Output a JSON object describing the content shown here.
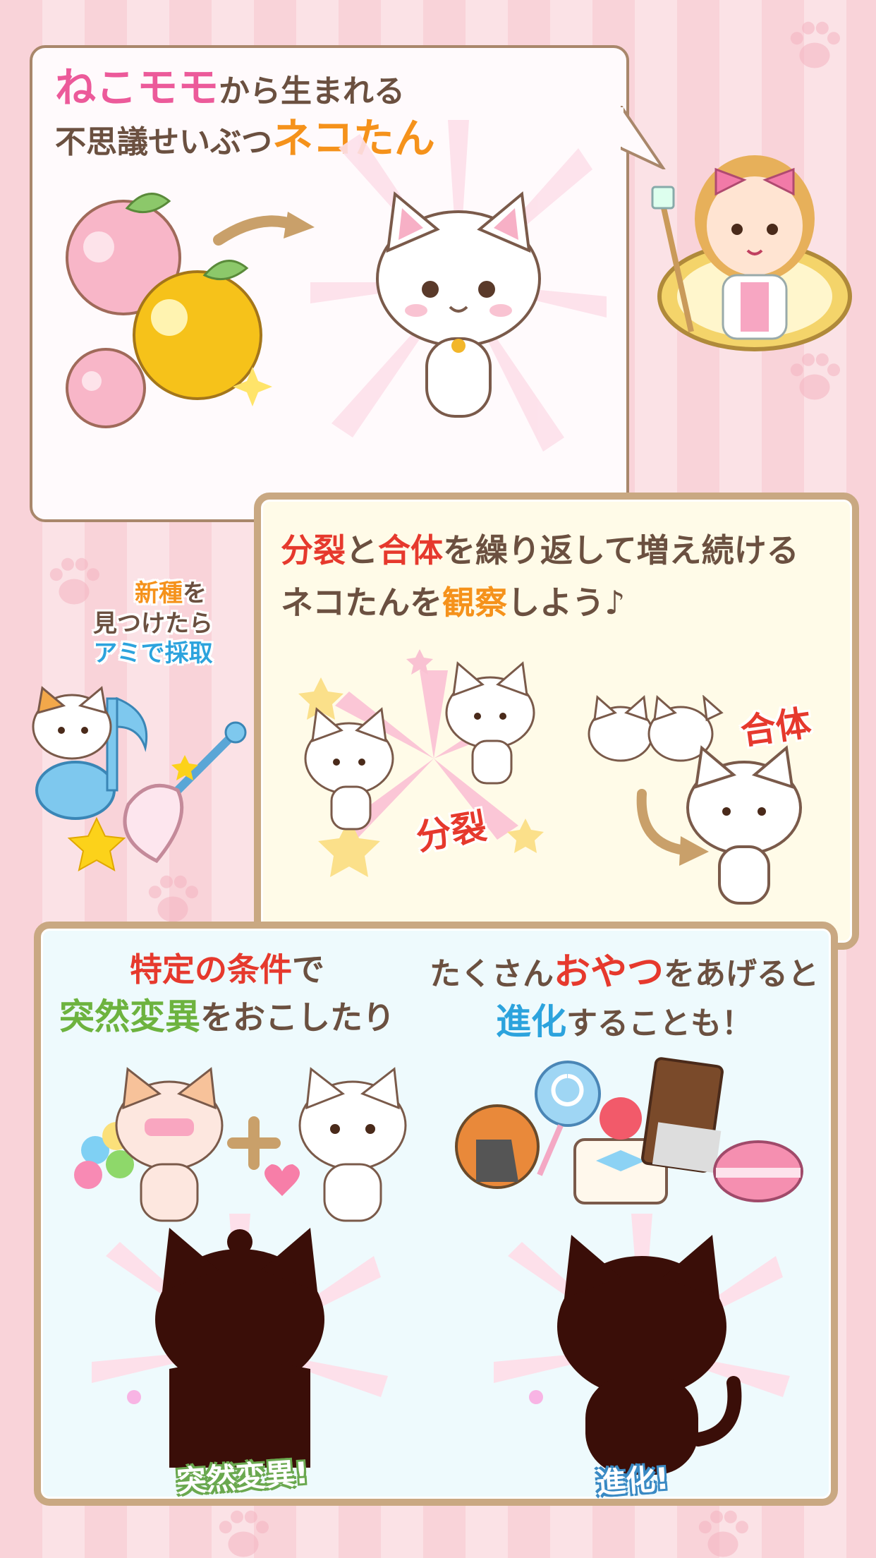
{
  "panel1": {
    "line1_highlight": "ねこモモ",
    "line1_rest": "から生まれる",
    "line2_rest": "不思議せいぶつ",
    "line2_highlight": "ネコたん"
  },
  "side_note": {
    "line1_a": "新種",
    "line1_b": "を",
    "line2": "見つけたら",
    "line3_a": "アミで",
    "line3_b": "採取"
  },
  "panel2": {
    "line1_a": "分裂",
    "line1_b": "と",
    "line1_c": "合体",
    "line1_d": "を繰り返して増え続ける",
    "line2_a": "ネコたんを",
    "line2_b": "観察",
    "line2_c": "しよう♪",
    "label_split": "分裂",
    "label_merge": "合体"
  },
  "panel3": {
    "left_line1_a": "特定の条件",
    "left_line1_b": "で",
    "left_line2_a": "突然変異",
    "left_line2_b": "をおこしたり",
    "right_line1_a": "たくさん",
    "right_line1_b": "おやつ",
    "right_line1_c": "をあげると",
    "right_line2_a": "進化",
    "right_line2_b": "することも！",
    "badge_mutation": "突然変異!",
    "badge_evolution": "進化!"
  },
  "colors": {
    "pink": "#ec5a9a",
    "orange": "#f5921b",
    "red": "#e6392d",
    "green": "#6db33f",
    "blue": "#2ca3dd",
    "brown": "#6b5040"
  }
}
